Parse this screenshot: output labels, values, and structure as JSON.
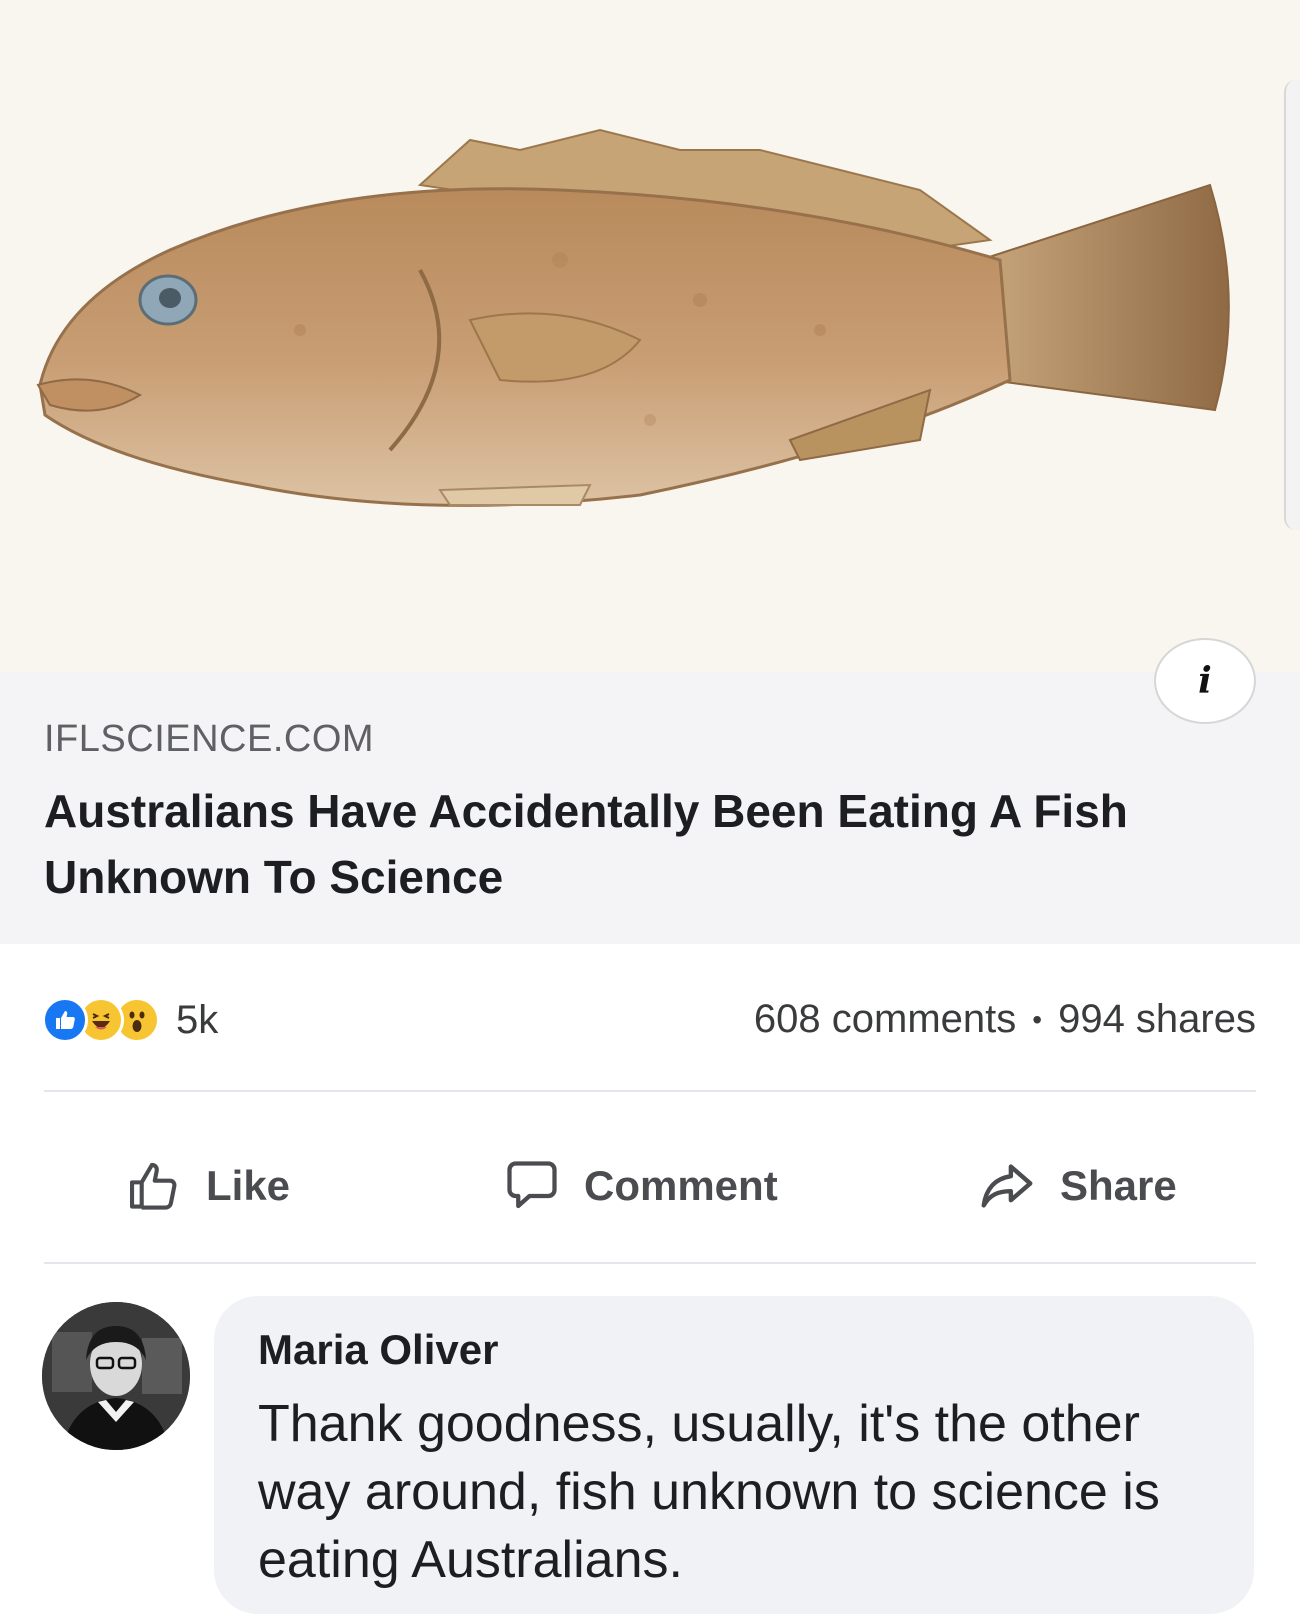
{
  "link_preview": {
    "image_subject": "fish",
    "domain": "IFLSCIENCE.COM",
    "title": "Australians Have Accidentally Been Eating A Fish Unknown To Science",
    "info_icon": "info-icon"
  },
  "reactions": {
    "icons": [
      "like-icon",
      "haha-icon",
      "wow-icon"
    ],
    "count": "5k"
  },
  "stats": {
    "comments": "608 comments",
    "separator": "•",
    "shares": "994 shares"
  },
  "actions": {
    "like_label": "Like",
    "comment_label": "Comment",
    "share_label": "Share"
  },
  "comment": {
    "author": "Maria Oliver",
    "text": "Thank goodness, usually, it's the other way around, fish unknown to science is eating Australians."
  },
  "colors": {
    "like_blue": "#1877f2",
    "reaction_yellow": "#f7c531",
    "bubble_bg": "#f0f2f5"
  }
}
